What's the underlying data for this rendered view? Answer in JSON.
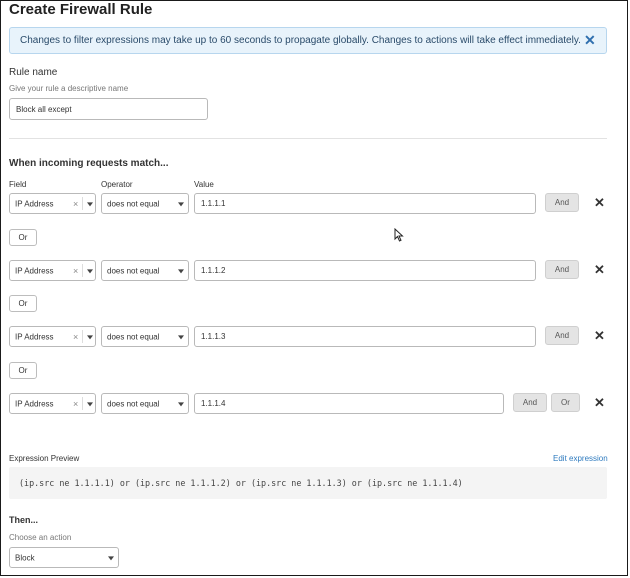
{
  "page": {
    "title": "Create Firewall Rule"
  },
  "notice": {
    "text": "Changes to filter expressions may take up to 60 seconds to propagate globally. Changes to actions will take effect immediately.",
    "close_icon": "close-icon"
  },
  "rule_name": {
    "label": "Rule name",
    "hint": "Give your rule a descriptive name",
    "value": "Block all except"
  },
  "match": {
    "heading": "When incoming requests match...",
    "field_label": "Field",
    "operator_label": "Operator",
    "value_label": "Value",
    "rows": [
      {
        "field": "IP Address",
        "clear": "×",
        "operator": "does not equal",
        "value": "1.1.1.1",
        "and_label": "And",
        "remove": "✕"
      },
      {
        "field": "IP Address",
        "clear": "×",
        "operator": "does not equal",
        "value": "1.1.1.2",
        "and_label": "And",
        "remove": "✕"
      },
      {
        "field": "IP Address",
        "clear": "×",
        "operator": "does not equal",
        "value": "1.1.1.3",
        "and_label": "And",
        "remove": "✕"
      },
      {
        "field": "IP Address",
        "clear": "×",
        "operator": "does not equal",
        "value": "1.1.1.4",
        "and_label": "And",
        "or_label": "Or",
        "remove": "✕"
      }
    ],
    "or_buttons": [
      "Or",
      "Or",
      "Or"
    ]
  },
  "preview": {
    "label": "Expression Preview",
    "edit_link": "Edit expression",
    "expression": "(ip.src ne 1.1.1.1) or (ip.src ne 1.1.1.2) or (ip.src ne 1.1.1.3) or (ip.src ne 1.1.1.4)"
  },
  "then": {
    "heading": "Then...",
    "hint": "Choose an action",
    "action": "Block"
  },
  "colors": {
    "accent": "#2f7bbf",
    "notice_bg": "#e8f3fb",
    "notice_border": "#b7d6ee"
  }
}
